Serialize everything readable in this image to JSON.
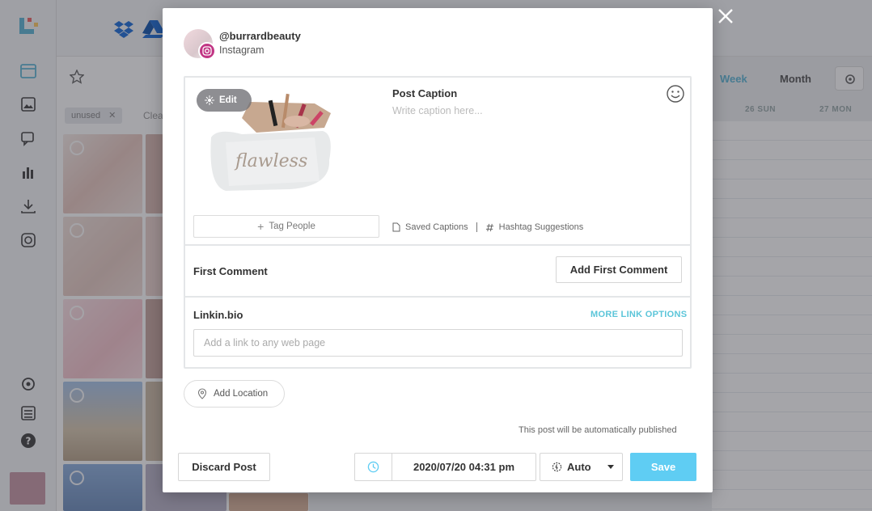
{
  "background": {
    "filter_chip": "unused",
    "clear_link": "Clea",
    "calendar_tabs": [
      "Week",
      "Month"
    ],
    "calendar_days": [
      "26 SUN",
      "27 MON"
    ]
  },
  "modal": {
    "account": {
      "handle": "@burrardbeauty",
      "network": "Instagram"
    },
    "media": {
      "edit_label": "Edit",
      "artwork_text": "flawless"
    },
    "tag_people_label": "Tag People",
    "caption": {
      "label": "Post Caption",
      "placeholder": "Write caption here...",
      "value": ""
    },
    "caption_tools": {
      "saved_captions": "Saved Captions",
      "hashtag_suggestions": "Hashtag Suggestions"
    },
    "first_comment": {
      "label": "First Comment",
      "button": "Add First Comment"
    },
    "linkinbio": {
      "label": "Linkin.bio",
      "more_options": "MORE LINK OPTIONS",
      "placeholder": "Add a link to any web page",
      "value": ""
    },
    "add_location_label": "Add Location",
    "auto_publish_note": "This post will be automatically published",
    "footer": {
      "discard_label": "Discard Post",
      "datetime": "2020/07/20 04:31 pm",
      "mode": "Auto",
      "save_label": "Save"
    }
  },
  "colors": {
    "save": "#5fcdf3",
    "link_accent": "#5bc5d9",
    "instagram_badge": "#c13584"
  }
}
